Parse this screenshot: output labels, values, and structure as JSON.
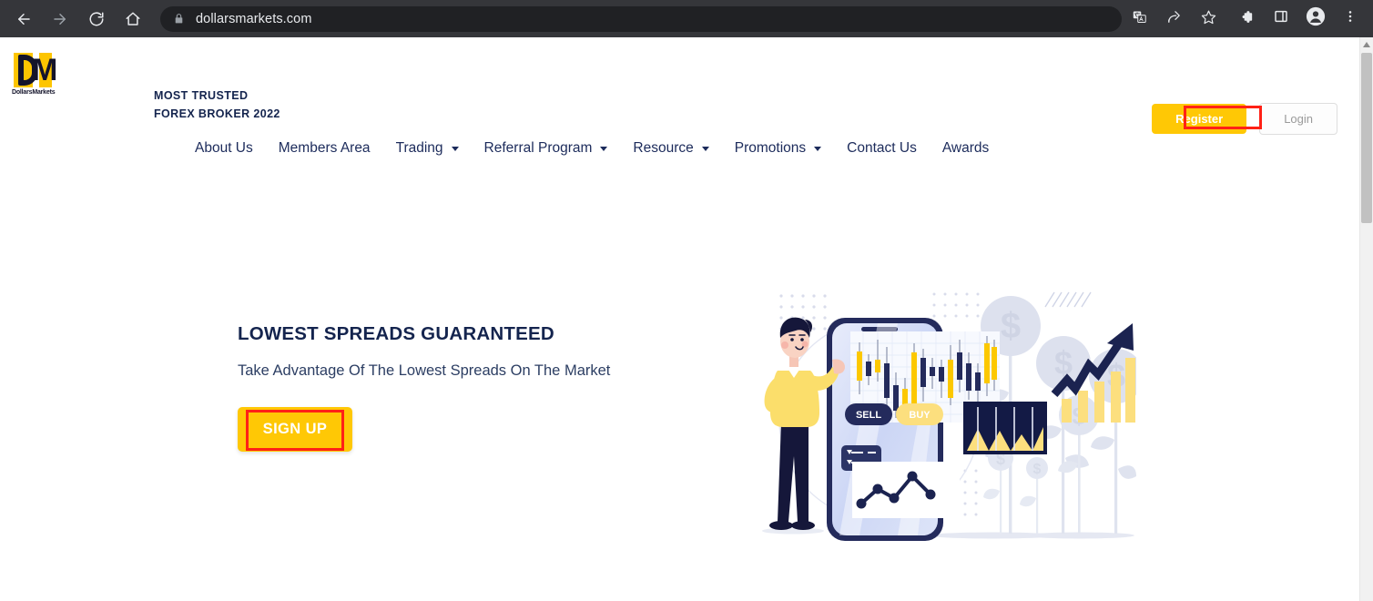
{
  "browser": {
    "back_icon": "back-arrow-icon",
    "forward_icon": "forward-arrow-icon",
    "reload_icon": "reload-icon",
    "home_icon": "home-icon",
    "lock_icon": "lock-icon",
    "url": "dollarsmarkets.com",
    "translate_icon": "translate-icon",
    "share_icon": "share-icon",
    "bookmark_icon": "bookmark-star-icon",
    "extensions_icon": "extensions-puzzle-icon",
    "sidepanel_icon": "side-panel-icon",
    "profile_icon": "profile-avatar-icon",
    "menu_icon": "three-dot-menu-icon"
  },
  "site": {
    "logo_letter_d": "D",
    "logo_letter_m": "M",
    "logo_caption": "DollarsMarkets",
    "tagline_line1": "MOST TRUSTED",
    "tagline_line2": "FOREX BROKER 2022",
    "register_label": "Register",
    "login_label": "Login"
  },
  "nav": {
    "items": [
      {
        "label": "About Us",
        "has_caret": false
      },
      {
        "label": "Members Area",
        "has_caret": false
      },
      {
        "label": "Trading",
        "has_caret": true
      },
      {
        "label": "Referral Program",
        "has_caret": true
      },
      {
        "label": "Resource",
        "has_caret": true
      },
      {
        "label": "Promotions",
        "has_caret": true
      },
      {
        "label": "Contact Us",
        "has_caret": false
      },
      {
        "label": "Awards",
        "has_caret": false
      }
    ]
  },
  "hero": {
    "title": "LOWEST SPREADS GUARANTEED",
    "subtitle": "Take Advantage Of The Lowest Spreads On The Market",
    "cta_label": "SIGN UP",
    "illustration": {
      "name": "forex-trading-illustration",
      "sell_label": "SELL",
      "buy_label": "BUY",
      "dollar_glyph": "$"
    }
  },
  "colors": {
    "brand_yellow": "#FFC805",
    "brand_navy": "#14244e",
    "annotation_red": "#FF2116",
    "illustration_navy": "#1b2350",
    "illustration_yellow": "#FCDF7E",
    "chrome_dark": "#35363a",
    "omnibox_dark": "#202124"
  },
  "annotations": {
    "register_highlight": "red-highlight-box",
    "signup_highlight": "red-highlight-box"
  },
  "scrollbar": {
    "up_arrow_icon": "scroll-up-arrow-icon",
    "thumb": "scrollbar-thumb"
  }
}
